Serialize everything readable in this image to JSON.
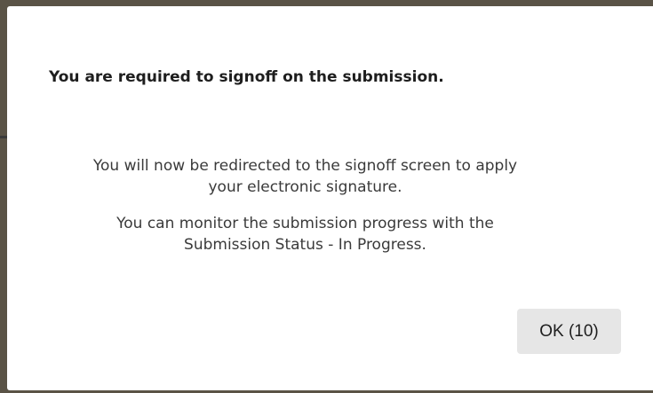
{
  "dialog": {
    "title": "You are required to signoff on the submission.",
    "body_line_1a": "You will now be redirected to the signoff screen to apply",
    "body_line_1b": "your electronic signature.",
    "body_line_2a": "You can monitor the submission progress with the",
    "body_line_2b": "Submission Status - In Progress.",
    "ok_button_label": "OK (10)"
  }
}
